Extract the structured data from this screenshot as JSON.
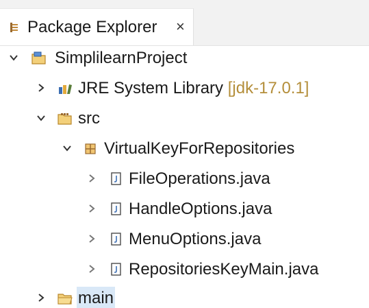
{
  "tab": {
    "title": "Package Explorer",
    "close": "×",
    "icon": "package-explorer-icon"
  },
  "tree": {
    "project": {
      "label": "SimplilearnProject",
      "icon": "project-folder-icon",
      "expanded": true
    },
    "jre": {
      "label": "JRE System Library",
      "decoration": "[jdk-17.0.1]",
      "icon": "library-icon",
      "expanded": false
    },
    "src": {
      "label": "src",
      "icon": "source-folder-icon",
      "expanded": true
    },
    "package": {
      "label": "VirtualKeyForRepositories",
      "icon": "package-icon",
      "expanded": true
    },
    "files": [
      {
        "label": "FileOperations.java",
        "icon": "java-file-icon"
      },
      {
        "label": "HandleOptions.java",
        "icon": "java-file-icon"
      },
      {
        "label": "MenuOptions.java",
        "icon": "java-file-icon"
      },
      {
        "label": "RepositoriesKeyMain.java",
        "icon": "java-file-icon"
      }
    ],
    "main": {
      "label": "main",
      "icon": "folder-icon",
      "expanded": false,
      "selected": true
    }
  },
  "colors": {
    "selection": "#d9e8f7",
    "decoration": "#b48e3a",
    "folder": "#e8b84a",
    "library": "#3d6fb3"
  }
}
